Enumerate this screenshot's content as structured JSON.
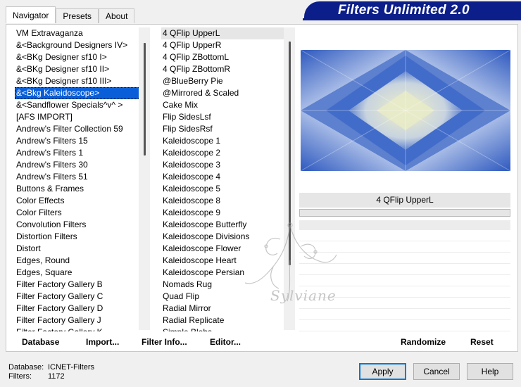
{
  "banner": {
    "title": "Filters Unlimited 2.0"
  },
  "tabs": [
    {
      "label": "Navigator",
      "active": true
    },
    {
      "label": "Presets",
      "active": false
    },
    {
      "label": "About",
      "active": false
    }
  ],
  "categories": [
    "VM Extravaganza",
    "&<Background Designers IV>",
    "&<BKg Designer sf10 I>",
    "&<BKg Designer sf10 II>",
    "&<BKg Designer sf10 III>",
    "&<Bkg Kaleidoscope>",
    "&<Sandflower Specials^v^ >",
    "[AFS IMPORT]",
    "Andrew's Filter Collection 59",
    "Andrew's Filters 15",
    "Andrew's Filters 1",
    "Andrew's Filters 30",
    "Andrew's Filters 51",
    "Buttons & Frames",
    "Color Effects",
    "Color Filters",
    "Convolution Filters",
    "Distortion Filters",
    "Distort",
    "Edges, Round",
    "Edges, Square",
    "Filter Factory Gallery B",
    "Filter Factory Gallery C",
    "Filter Factory Gallery D",
    "Filter Factory Gallery J",
    "Filter Factory Gallery K"
  ],
  "selected_category": "&<Bkg Kaleidoscope>",
  "filters": [
    "4 QFlip UpperL",
    "4 QFlip UpperR",
    "4 QFlip ZBottomL",
    "4 QFlip ZBottomR",
    "@BlueBerry Pie",
    "@Mirrored & Scaled",
    "Cake Mix",
    "Flip SidesLsf",
    "Flip SidesRsf",
    "Kaleidoscope 1",
    "Kaleidoscope 2",
    "Kaleidoscope 3",
    "Kaleidoscope 4",
    "Kaleidoscope 5",
    "Kaleidoscope 8",
    "Kaleidoscope 9",
    "Kaleidoscope Butterfly",
    "Kaleidoscope Divisions",
    "Kaleidoscope Flower",
    "Kaleidoscope Heart",
    "Kaleidoscope Persian",
    "Nomads Rug",
    "Quad Flip",
    "Radial Mirror",
    "Radial Replicate",
    "Simple Blobs"
  ],
  "selected_filter": "4 QFlip UpperL",
  "preview": {
    "filter_name": "4 QFlip UpperL"
  },
  "watermark": {
    "text": "Sylviane"
  },
  "panel_buttons": {
    "database": "Database",
    "import": "Import...",
    "filter_info": "Filter Info...",
    "editor": "Editor...",
    "randomize": "Randomize",
    "reset": "Reset"
  },
  "status": {
    "database_label": "Database:",
    "database_value": "ICNET-Filters",
    "filters_label": "Filters:",
    "filters_value": "1172"
  },
  "dialog_buttons": {
    "apply": "Apply",
    "cancel": "Cancel",
    "help": "Help"
  },
  "colors": {
    "banner": "#0c1e8a",
    "selection": "#0a5fd8",
    "preview_blue": "#3a63c4",
    "preview_cream": "#e9ebc8"
  }
}
